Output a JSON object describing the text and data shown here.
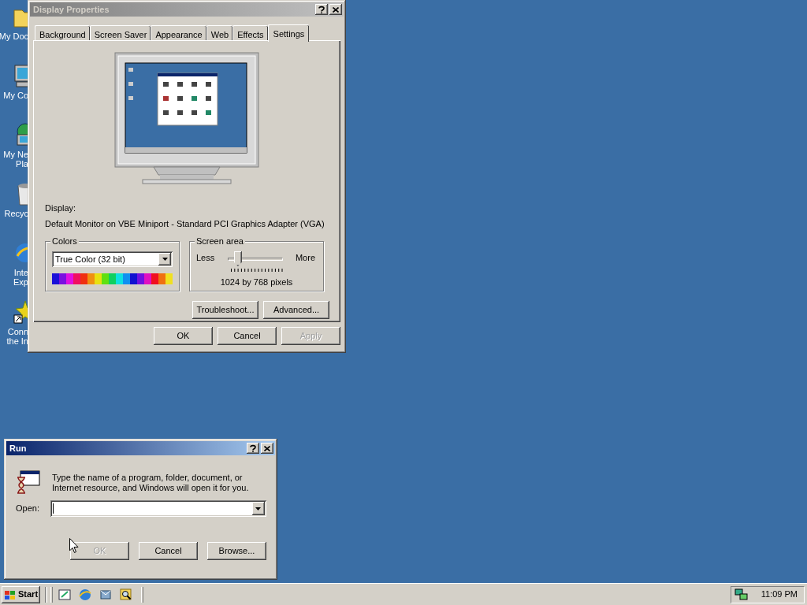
{
  "desktop_icons": [
    {
      "kind": "folder",
      "lines": [
        "My Doc"
      ]
    },
    {
      "kind": "computer",
      "lines": [
        "My Co"
      ]
    },
    {
      "kind": "network",
      "lines": [
        "My Ne",
        "Pla"
      ]
    },
    {
      "kind": "bin",
      "lines": [
        "Recyc"
      ]
    },
    {
      "kind": "browser",
      "lines": [
        "Inte",
        "Exp"
      ]
    },
    {
      "kind": "shortcut",
      "lines": [
        "Conn",
        "the In"
      ]
    }
  ],
  "display_dialog": {
    "title": "Display Properties",
    "active": false,
    "tabs": [
      {
        "label": "Background",
        "selected": false
      },
      {
        "label": "Screen Saver",
        "selected": false
      },
      {
        "label": "Appearance",
        "selected": false
      },
      {
        "label": "Web",
        "selected": false
      },
      {
        "label": "Effects",
        "selected": false
      },
      {
        "label": "Settings",
        "selected": true
      }
    ],
    "display_label": "Display:",
    "display_name": "Default Monitor on VBE Miniport - Standard PCI Graphics Adapter (VGA)",
    "colors": {
      "title": "Colors",
      "value": "True Color (32 bit)"
    },
    "screen_area": {
      "title": "Screen area",
      "less": "Less",
      "more": "More",
      "level": 0.17,
      "reading": "1024 by 768 pixels"
    },
    "panel_buttons": [
      "Troubleshoot...",
      "Advanced..."
    ],
    "buttons": [
      {
        "label": "OK",
        "disabled": false
      },
      {
        "label": "Cancel",
        "disabled": false
      },
      {
        "label": "Apply",
        "disabled": true
      }
    ]
  },
  "run_dialog": {
    "title": "Run",
    "active": true,
    "message": "Type the name of a program, folder, document, or Internet resource, and Windows will open it for you.",
    "open_label": "Open:",
    "buttons": [
      {
        "label": "OK",
        "disabled": true
      },
      {
        "label": "Cancel",
        "disabled": false
      },
      {
        "label": "Browse...",
        "disabled": false
      }
    ]
  },
  "taskbar": {
    "start": "Start",
    "quick_launch": [
      {
        "kind": "desktop"
      },
      {
        "kind": "browser"
      },
      {
        "kind": "mail"
      },
      {
        "kind": "search"
      }
    ],
    "clock": "11:09 PM"
  }
}
